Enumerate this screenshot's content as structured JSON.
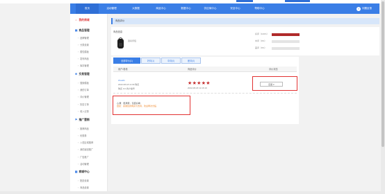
{
  "topnav": {
    "items": [
      "首页",
      "活动管理",
      "大数据",
      "商品中心",
      "数据中心",
      "供应商中心",
      "安全中心",
      "帮助中心"
    ],
    "user_label": "问题反馈"
  },
  "sidebar": {
    "sections": [
      {
        "title": "我的商城",
        "items": []
      },
      {
        "title": "商品管理",
        "items": [
          "品牌管理",
          "分类设置",
          "属性模板",
          "发布商品",
          "库存管理"
        ]
      },
      {
        "title": "交易管理",
        "items": [
          "搜索模板",
          "我的订单",
          "评价管理",
          "历史订单",
          "收入记录"
        ]
      },
      {
        "title": "推广营销",
        "items": [
          "推荐商品",
          "优惠券",
          "入驻区域推荐",
          "我的返回推广",
          "广告推广",
          "活动管理"
        ]
      },
      {
        "title": "商城中心",
        "items": [
          "配送设置",
          "商品设置"
        ]
      }
    ]
  },
  "page_header": "商品评价",
  "product": {
    "label": "商品信息",
    "name": "双肩背包"
  },
  "ratings": [
    {
      "label": "好评（100%）",
      "value": 1.0
    },
    {
      "label": "中评（0%）",
      "value": 0.0
    },
    {
      "label": "差评（0%）",
      "value": 0.0
    }
  ],
  "tabs": [
    "全部评价(1)",
    "好评(1)",
    "中评(0)",
    "差评(0)"
  ],
  "table": {
    "headers": [
      "用户/看看",
      "商品评价",
      "评价状态"
    ],
    "row": {
      "user": "zhao01",
      "date1": "2022-08-18 11:09 购买",
      "date2": "购买 0.0 商户编号",
      "date3": "2022-08-18 11:16:19",
      "button": "回复 ▾"
    }
  },
  "review": {
    "text": "心满：很满意，包装好看",
    "reply": "回复：感谢您的购买与支持，欢迎再次光临"
  },
  "colors": {
    "accent": "#3a7ee6",
    "alert": "#e23030",
    "star": "#c42a2a",
    "bar": "#b02a2a"
  }
}
